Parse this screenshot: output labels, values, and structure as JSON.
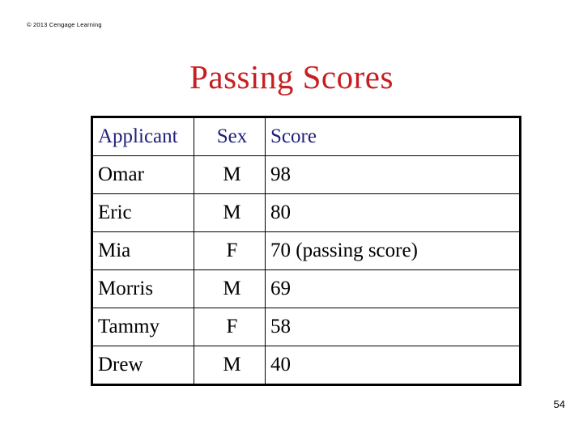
{
  "slide": {
    "copyright": "© 2013 Cengage Learning",
    "title": "Passing Scores",
    "page_number": "54",
    "colors": {
      "title": "#c61f22",
      "table_header_text": "#1f1f7a",
      "table_body_text": "#000000",
      "table_border": "#000000",
      "background": "#ffffff"
    }
  },
  "table": {
    "columns": [
      {
        "key": "applicant",
        "label": "Applicant",
        "align": "left"
      },
      {
        "key": "sex",
        "label": "Sex",
        "align": "center"
      },
      {
        "key": "score",
        "label": "Score",
        "align": "left"
      }
    ],
    "rows": [
      {
        "applicant": "Omar",
        "sex": "M",
        "score": "98"
      },
      {
        "applicant": "Eric",
        "sex": "M",
        "score": "80"
      },
      {
        "applicant": "Mia",
        "sex": "F",
        "score": "70 (passing score)"
      },
      {
        "applicant": "Morris",
        "sex": "M",
        "score": "69"
      },
      {
        "applicant": "Tammy",
        "sex": "F",
        "score": "58"
      },
      {
        "applicant": "Drew",
        "sex": "M",
        "score": "40"
      }
    ]
  }
}
